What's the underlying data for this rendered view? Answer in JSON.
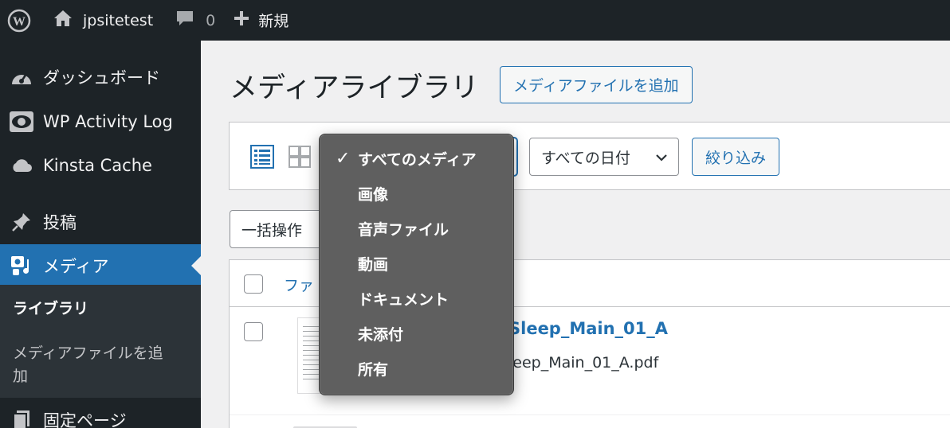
{
  "adminbar": {
    "site_name": "jpsitetest",
    "comments_count": "0",
    "new_label": "新規"
  },
  "sidebar": {
    "items": [
      {
        "label": "ダッシュボード",
        "icon": "dashboard-icon"
      },
      {
        "label": "WP Activity Log",
        "icon": "eye-icon"
      },
      {
        "label": "Kinsta Cache",
        "icon": "cloud-icon"
      },
      {
        "label": "投稿",
        "icon": "pin-icon"
      },
      {
        "label": "メディア",
        "icon": "media-icon"
      },
      {
        "label": "固定ページ",
        "icon": "page-icon"
      }
    ],
    "submenu": {
      "library": "ライブラリ",
      "add_new_line1": "メディアファイルを追",
      "add_new_line2": "加"
    }
  },
  "main": {
    "title": "メディアライブラリ",
    "add_new_button": "メディアファイルを追加",
    "date_filter": "すべての日付",
    "filter_button": "絞り込み",
    "bulk_actions": "一括操作",
    "table_header_file": "ファ",
    "rows": [
      {
        "title": "Sleep_Main_01_A",
        "filename": "leep_Main_01_A.pdf"
      }
    ]
  },
  "dropdown": {
    "selected": "すべてのメディア",
    "options": [
      "すべてのメディア",
      "画像",
      "音声ファイル",
      "動画",
      "ドキュメント",
      "未添付",
      "所有"
    ]
  },
  "colors": {
    "accent": "#2271b1",
    "adminbar_bg": "#1d2327",
    "submenu_bg": "#2c3338",
    "dropdown_bg": "#5f5f5f"
  }
}
